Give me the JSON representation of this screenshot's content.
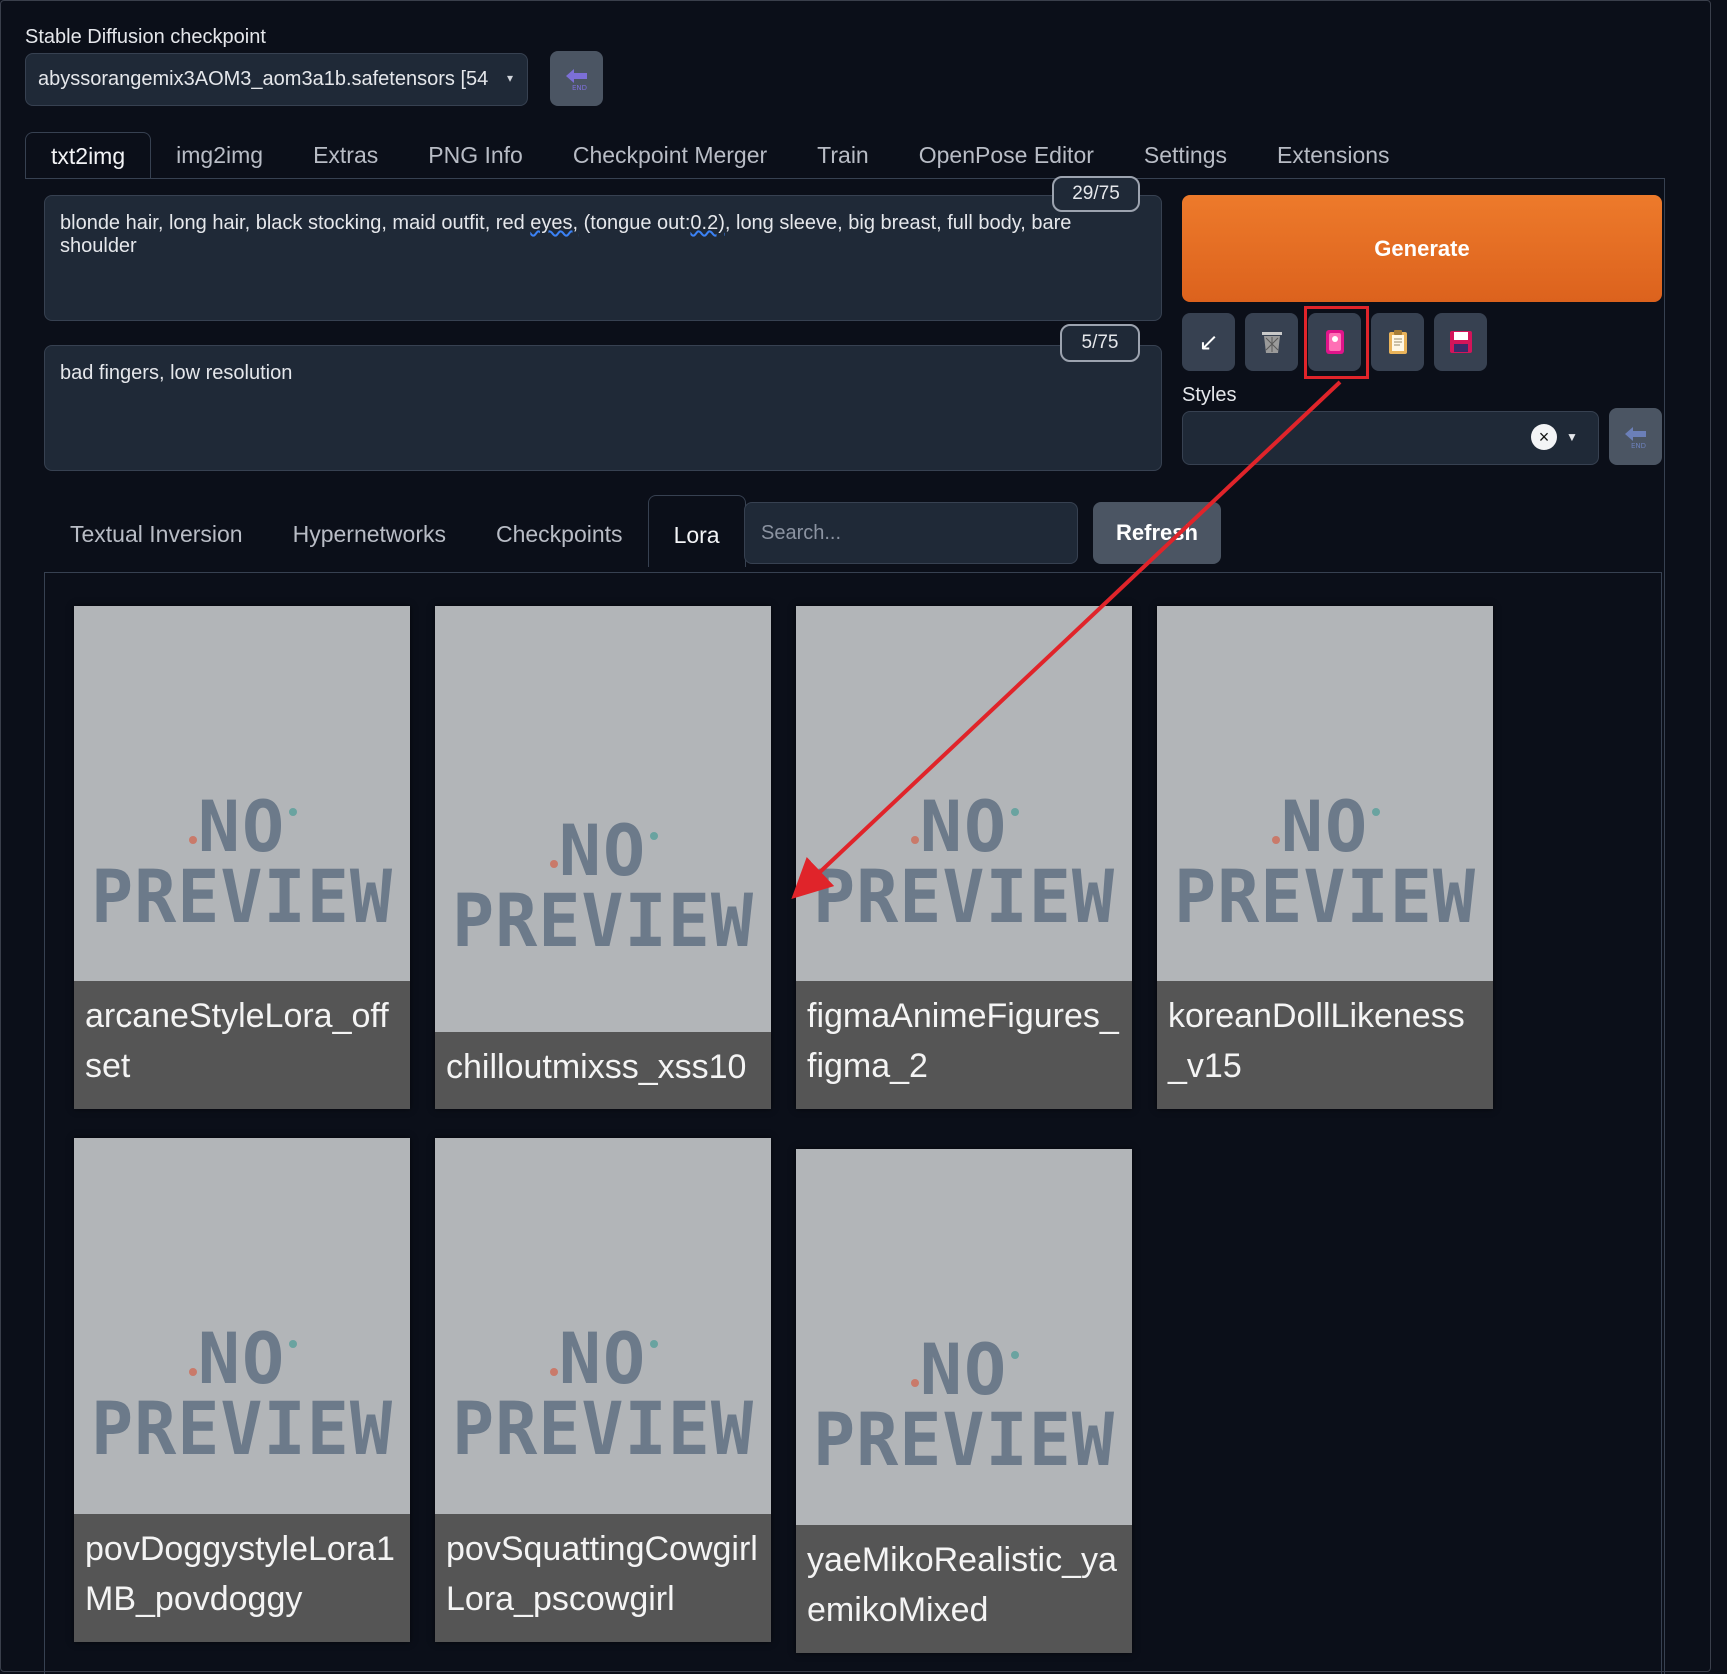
{
  "checkpoint": {
    "label": "Stable Diffusion checkpoint",
    "value": "abyssorangemix3AOM3_aom3a1b.safetensors [54"
  },
  "tabs": [
    "txt2img",
    "img2img",
    "Extras",
    "PNG Info",
    "Checkpoint Merger",
    "Train",
    "OpenPose Editor",
    "Settings",
    "Extensions"
  ],
  "prompt": {
    "counter": "29/75",
    "text_before": "blonde hair, long hair, black stocking, maid outfit, red ",
    "text_mark1": "eyes,",
    "text_mid": " (tongue out:",
    "text_mark2": "0.2),",
    "text_after": " long sleeve, big breast, full body, bare shoulder"
  },
  "negative_prompt": {
    "counter": "5/75",
    "text": "bad fingers, low resolution"
  },
  "generate_label": "Generate",
  "tool_icons": [
    "arrow-icon",
    "trash-icon",
    "extra-networks-icon",
    "clipboard-icon",
    "save-icon"
  ],
  "styles": {
    "label": "Styles",
    "value": "",
    "clear": "×"
  },
  "extra_networks": {
    "tabs": [
      "Textual Inversion",
      "Hypernetworks",
      "Checkpoints",
      "Lora"
    ],
    "search_placeholder": "Search...",
    "refresh_label": "Refresh"
  },
  "cards": [
    {
      "name": "arcaneStyleLora_offset",
      "image_text": [
        "NO",
        "PREVIEW"
      ]
    },
    {
      "name": "chilloutmixss_xss10",
      "image_text": [
        "NO",
        "PREVIEW"
      ]
    },
    {
      "name": "figmaAnimeFigures_figma_2",
      "image_text": [
        "NO",
        "PREVIEW"
      ]
    },
    {
      "name": "koreanDollLikeness_v15",
      "image_text": [
        "NO",
        "PREVIEW"
      ]
    },
    {
      "name": "povDoggystyleLora1MB_povdoggy",
      "image_text": [
        "NO",
        "PREVIEW"
      ]
    },
    {
      "name": "povSquattingCowgirlLora_pscowgirl",
      "image_text": [
        "NO",
        "PREVIEW"
      ]
    },
    {
      "name": "yaeMikoRealistic_yaemikoMixed",
      "image_text": [
        "NO",
        "PREVIEW"
      ]
    }
  ],
  "colors": {
    "background": "#0b0f19",
    "generate": "#e8722a",
    "annotation": "#e0242a"
  }
}
